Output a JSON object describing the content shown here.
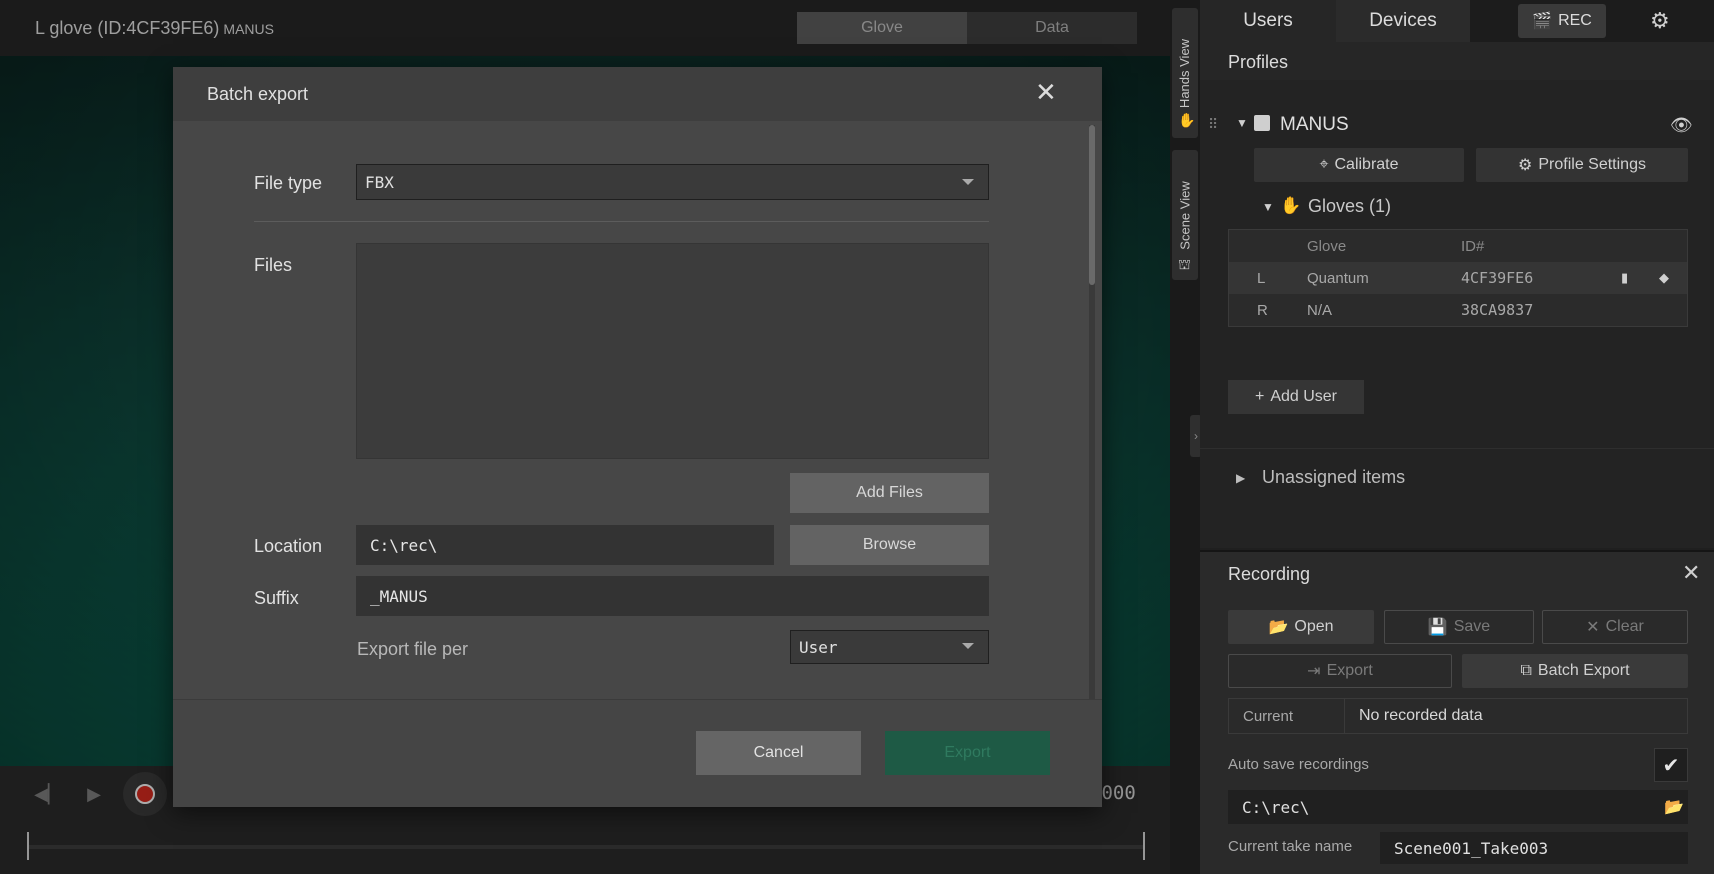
{
  "viewport": {
    "title": "L glove (ID:4CF39FE6)",
    "title_suffix": "MANUS",
    "tabs": [
      "Glove",
      "Data"
    ],
    "time_readout": ":000"
  },
  "side_tabs": {
    "hands_view": "Hands View",
    "scene_view": "Scene View"
  },
  "right_panel": {
    "tabs": [
      "Users",
      "Devices"
    ],
    "rec_button": "REC",
    "profiles_title": "Profiles",
    "profile": {
      "name": "MANUS",
      "calibrate_label": "Calibrate",
      "profile_settings_label": "Profile Settings",
      "gloves_label": "Gloves (1)",
      "table": {
        "headers": [
          "Glove",
          "ID#"
        ],
        "rows": [
          {
            "side": "L",
            "glove": "Quantum",
            "id": "4CF39FE6"
          },
          {
            "side": "R",
            "glove": "N/A",
            "id": "38CA9837"
          }
        ]
      }
    },
    "add_user_label": "Add User",
    "unassigned_label": "Unassigned items"
  },
  "recording": {
    "title": "Recording",
    "open_label": "Open",
    "save_label": "Save",
    "clear_label": "Clear",
    "export_label": "Export",
    "batch_export_label": "Batch Export",
    "current_label": "Current",
    "current_value": "No recorded data",
    "auto_save_label": "Auto save recordings",
    "auto_save_checked": true,
    "path": "C:\\rec\\",
    "take_name_label": "Current take name",
    "take_name": "Scene001_Take003"
  },
  "modal": {
    "title": "Batch export",
    "file_type_label": "File type",
    "file_type_value": "FBX",
    "files_label": "Files",
    "add_files_label": "Add Files",
    "location_label": "Location",
    "location_value": "C:\\rec\\",
    "browse_label": "Browse",
    "suffix_label": "Suffix",
    "suffix_value": "_MANUS",
    "export_per_label": "Export file per",
    "export_per_value": "User",
    "cancel_label": "Cancel",
    "export_label": "Export"
  },
  "colors": {
    "accent_export": "#1e5a45",
    "rec_red": "#d22a1f"
  }
}
